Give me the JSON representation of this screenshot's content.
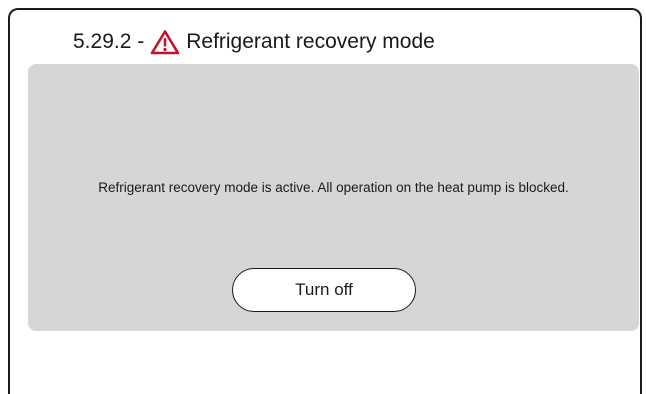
{
  "header": {
    "code": "5.29.2 -",
    "title": "Refrigerant recovery mode",
    "icon": "warning-triangle-icon",
    "icon_color": "#c8102e"
  },
  "panel": {
    "message": "Refrigerant recovery mode is active. All operation on the heat pump is blocked.",
    "button_label": "Turn off"
  },
  "colors": {
    "panel_background": "#d5d6d8",
    "text": "#1a1a1a",
    "button_background": "#ffffff"
  }
}
